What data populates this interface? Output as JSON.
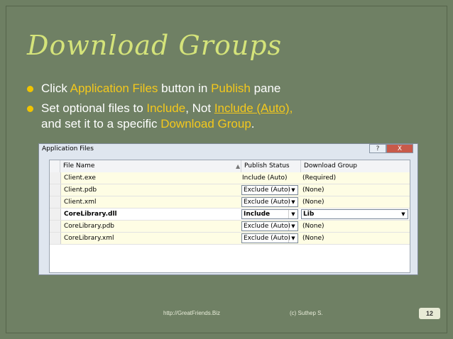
{
  "slide": {
    "title": "Download Groups",
    "bullets": [
      [
        "Click ",
        "Application Files",
        " button in ",
        "Publish",
        " pane"
      ],
      [
        "Set optional files to ",
        "Include",
        ", Not ",
        "Include (Auto)",
        ","
      ],
      [
        "and set it to a specific ",
        "Download Group",
        "."
      ]
    ],
    "footer_url": "http://GreatFriends.Biz",
    "footer_copyright": "(c) Suthep S.",
    "page_number": "12"
  },
  "window": {
    "title": "Application Files",
    "help_label": "?",
    "close_label": "X",
    "columns": [
      "File Name",
      "Publish Status",
      "Download Group"
    ],
    "sort_glyph": "▲",
    "dropdown_glyph": "▼",
    "rows": [
      {
        "file": "Client.exe",
        "status": "Include (Auto)",
        "group": "(Required)"
      },
      {
        "file": "Client.pdb",
        "status": "Exclude (Auto)",
        "group": "(None)"
      },
      {
        "file": "Client.xml",
        "status": "Exclude (Auto)",
        "group": "(None)"
      },
      {
        "file": "CoreLibrary.dll",
        "status": "Include",
        "group": "Lib"
      },
      {
        "file": "CoreLibrary.pdb",
        "status": "Exclude (Auto)",
        "group": "(None)"
      },
      {
        "file": "CoreLibrary.xml",
        "status": "Exclude (Auto)",
        "group": "(None)"
      }
    ]
  }
}
